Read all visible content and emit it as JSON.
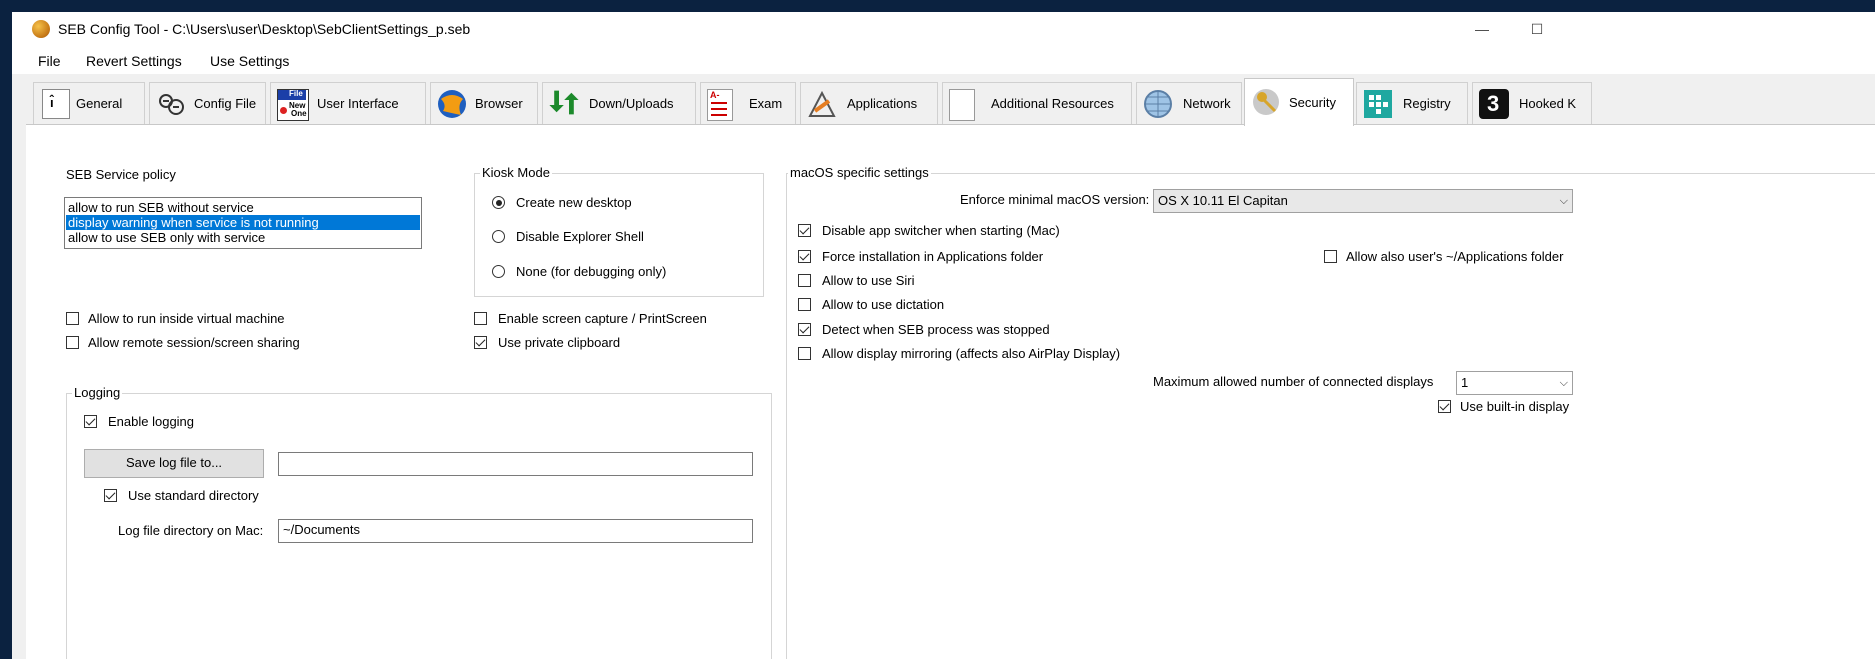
{
  "window": {
    "title": "SEB Config Tool - C:\\Users\\user\\Desktop\\SebClientSettings_p.seb",
    "minimize": "—",
    "maximize": "☐"
  },
  "menu": {
    "file": "File",
    "revert": "Revert Settings",
    "use": "Use Settings"
  },
  "tabs": {
    "general": "General",
    "config_file": "Config File",
    "user_interface": "User Interface",
    "browser": "Browser",
    "down_uploads": "Down/Uploads",
    "exam": "Exam",
    "applications": "Applications",
    "additional_resources": "Additional Resources",
    "network": "Network",
    "security": "Security",
    "registry": "Registry",
    "hooked_keys": "Hooked K",
    "general_icon_text": "ı̂",
    "config_icon_top": "File",
    "config_icon_mid": "New",
    "config_icon_bot": "One",
    "exam_icon_text": "A-",
    "hooked_icon_text": "3"
  },
  "service_policy": {
    "title": "SEB Service policy",
    "options": [
      "allow to run SEB without service",
      "display warning when service is not running",
      "allow to use SEB only with service"
    ],
    "selected_index": 1
  },
  "kiosk": {
    "title": "Kiosk Mode",
    "create_desktop": "Create new desktop",
    "disable_explorer": "Disable Explorer Shell",
    "none_debug": "None (for debugging only)",
    "selected": "Create new desktop"
  },
  "left_options": {
    "virtual_machine": "Allow to run inside virtual machine",
    "remote_session": "Allow remote session/screen sharing"
  },
  "mid_options": {
    "screen_capture": "Enable screen capture / PrintScreen",
    "private_clipboard": "Use private clipboard"
  },
  "macos": {
    "title": "macOS specific settings",
    "min_version_label": "Enforce minimal macOS version:",
    "min_version_value": "OS X 10.11 El Capitan",
    "app_switcher": "Disable app switcher when starting (Mac)",
    "force_install": "Force installation in Applications folder",
    "user_apps_folder": "Allow also user's ~/Applications folder",
    "siri": "Allow to use Siri",
    "dictation": "Allow to use dictation",
    "detect_stopped": "Detect when SEB process was stopped",
    "display_mirroring": "Allow display mirroring (affects also AirPlay Display)",
    "max_displays_label": "Maximum allowed number of connected displays",
    "max_displays_value": "1",
    "builtin_display": "Use built-in display"
  },
  "logging": {
    "title": "Logging",
    "enable": "Enable logging",
    "save_button": "Save log file to...",
    "save_path": "",
    "standard_dir": "Use standard directory",
    "mac_dir_label": "Log file directory on Mac:",
    "mac_dir_value": "~/Documents"
  },
  "colors": {
    "selection": "#0078d7",
    "title_bar_edge": "#0b2240"
  }
}
